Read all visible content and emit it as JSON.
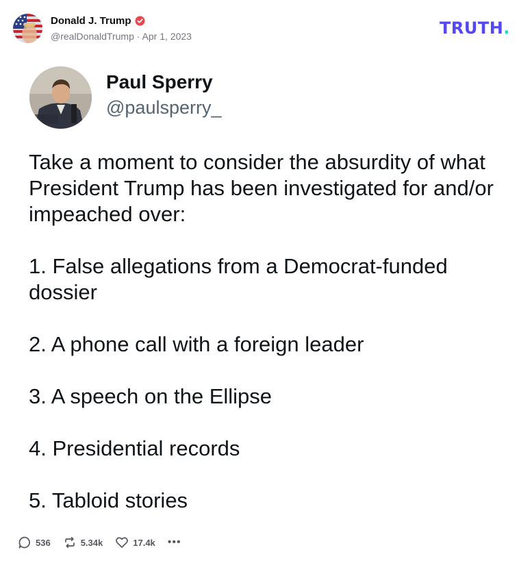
{
  "post": {
    "author": "Donald J. Trump",
    "handle": "@realDonaldTrump",
    "separator": "·",
    "date": "Apr 1, 2023"
  },
  "brand": {
    "logo": "TRUTH",
    "logo_dot": "."
  },
  "quoted": {
    "name": "Paul Sperry",
    "handle": "@paulsperry_",
    "intro": "Take a moment to consider the absurdity of what President Trump has been investigated for and/or impeached over:",
    "items": [
      "1. False allegations from a Democrat-funded dossier",
      "2. A phone call with a foreign leader",
      "3. A speech on the Ellipse",
      "4. Presidential records",
      "5. Tabloid stories"
    ]
  },
  "actions": {
    "replies": "536",
    "retruths": "5.34k",
    "likes": "17.4k",
    "more": "•••"
  },
  "colors": {
    "brand_purple": "#5448ee",
    "brand_teal": "#17d8d0",
    "verified": "#e5484d",
    "meta_gray": "#757582"
  },
  "icons": [
    "flag-avatar",
    "verified-badge-icon",
    "reply-icon",
    "retruth-icon",
    "heart-icon",
    "more-icon"
  ]
}
